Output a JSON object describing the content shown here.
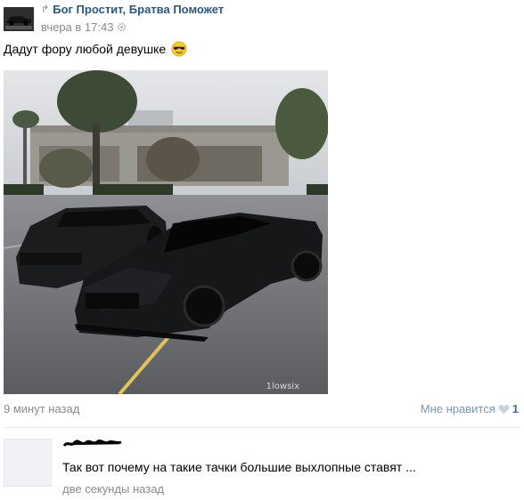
{
  "post": {
    "author": "Бог Простит, Братва Поможет",
    "time": "вчера в 17:43",
    "text": "Дадут фору любой девушке",
    "emoji": "sunglasses-emoji",
    "photo": {
      "description_icon": "photo-two-black-sports-cars",
      "watermark": "1lowsix"
    },
    "footer": {
      "ago": "9 минут назад",
      "like_label": "Мне нравится",
      "like_count": "1"
    }
  },
  "comment": {
    "text": "Так вот почему на такие тачки большие выхлопные ставят ...",
    "time": "две секунды назад"
  },
  "colors": {
    "author_link": "#2b587a",
    "meta_gray": "#8a8a8a",
    "like_blue": "#7b95b3",
    "like_count": "#45688e"
  }
}
